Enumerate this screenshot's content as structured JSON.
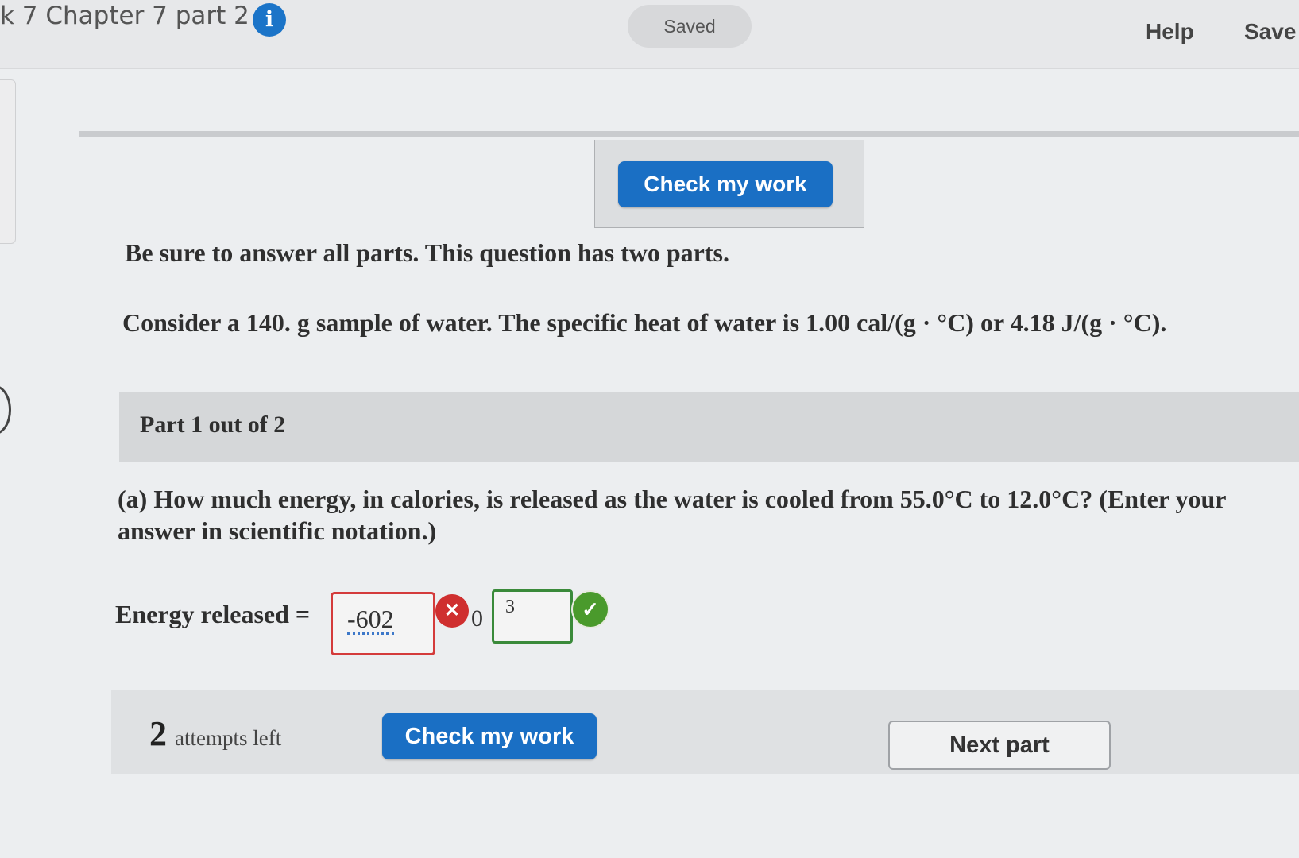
{
  "header": {
    "assignment_title": "k 7 Chapter 7 part 2",
    "info_icon_glyph": "i",
    "save_status": "Saved",
    "help_label": "Help",
    "save_label": "Save"
  },
  "top_check_button_label": "Check my work",
  "question": {
    "instruction": "Be sure to answer all parts. This question has two parts.",
    "problem": "Consider a 140. g sample of water. The specific heat of water is 1.00 cal/(g · °C) or 4.18 J/(g · °C)."
  },
  "part": {
    "label": "Part 1 out of 2",
    "subquestion": "(a) How much energy, in calories, is released as the water is cooled from 55.0°C to 12.0°C? (Enter your answer in scientific notation.)"
  },
  "answer": {
    "label": "Energy released =",
    "coefficient_value": "-602",
    "coefficient_status": "incorrect",
    "coefficient_status_glyph": "✕",
    "times_ten": "0",
    "exponent_value": "3",
    "exponent_status": "correct",
    "exponent_status_glyph": "✓"
  },
  "footer": {
    "attempts_count": "2",
    "attempts_label": "attempts left",
    "check_button_label": "Check my work",
    "next_button_label": "Next part"
  },
  "colors": {
    "primary_button": "#1a6fc4",
    "incorrect": "#d43b3b",
    "correct": "#3a8a3a",
    "info_icon": "#1b74c8"
  }
}
